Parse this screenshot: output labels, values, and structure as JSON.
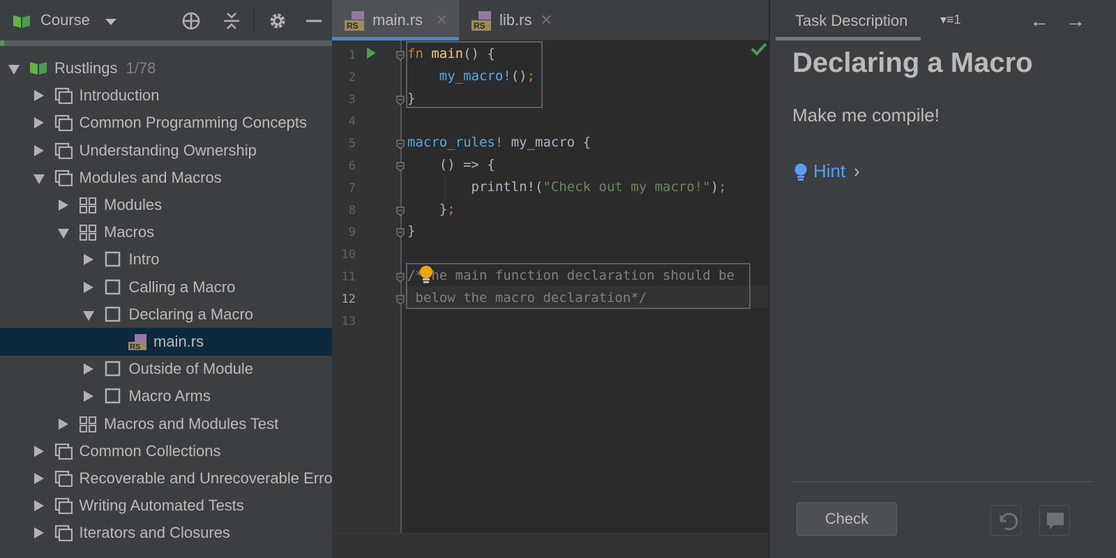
{
  "left_panel": {
    "title": "Course",
    "progress_fraction": 0.013,
    "tree": [
      {
        "label": "Rustlings",
        "count": "1/78",
        "level": 0,
        "expanded": true,
        "icon": "course-book-icon"
      },
      {
        "label": "Introduction",
        "level": 1,
        "expanded": false,
        "icon": "section-icon"
      },
      {
        "label": "Common Programming Concepts",
        "level": 1,
        "expanded": false,
        "icon": "section-icon"
      },
      {
        "label": "Understanding Ownership",
        "level": 1,
        "expanded": false,
        "icon": "section-icon"
      },
      {
        "label": "Modules and Macros",
        "level": 1,
        "expanded": true,
        "icon": "section-icon"
      },
      {
        "label": "Modules",
        "level": 2,
        "expanded": false,
        "icon": "lesson-grid-icon"
      },
      {
        "label": "Macros",
        "level": 2,
        "expanded": true,
        "icon": "lesson-grid-icon"
      },
      {
        "label": "Intro",
        "level": 3,
        "expanded": false,
        "icon": "task-icon"
      },
      {
        "label": "Calling a Macro",
        "level": 3,
        "expanded": false,
        "icon": "task-icon"
      },
      {
        "label": "Declaring a Macro",
        "level": 3,
        "expanded": true,
        "icon": "task-icon"
      },
      {
        "label": "main.rs",
        "level": 4,
        "leaf": true,
        "selected": true,
        "icon": "rust-file-icon"
      },
      {
        "label": "Outside of Module",
        "level": 3,
        "expanded": false,
        "icon": "task-icon"
      },
      {
        "label": "Macro Arms",
        "level": 3,
        "expanded": false,
        "icon": "task-icon"
      },
      {
        "label": "Macros and Modules Test",
        "level": 2,
        "expanded": false,
        "icon": "lesson-grid-icon"
      },
      {
        "label": "Common Collections",
        "level": 1,
        "expanded": false,
        "icon": "section-icon"
      },
      {
        "label": "Recoverable and Unrecoverable Errors",
        "level": 1,
        "expanded": false,
        "icon": "section-icon"
      },
      {
        "label": "Writing Automated Tests",
        "level": 1,
        "expanded": false,
        "icon": "section-icon"
      },
      {
        "label": "Iterators and Closures",
        "level": 1,
        "expanded": false,
        "icon": "section-icon"
      }
    ]
  },
  "editor": {
    "tabs": [
      {
        "label": "main.rs",
        "active": true
      },
      {
        "label": "lib.rs",
        "active": false
      }
    ],
    "current_line": 12,
    "lines": [
      {
        "n": "1",
        "html": "<span class=\"kw\">fn</span> <span class=\"fn\">main</span>() {"
      },
      {
        "n": "2",
        "html": "    <span class=\"mac\">my_macro!</span>()<span class=\"semi\">;</span>"
      },
      {
        "n": "3",
        "html": "}"
      },
      {
        "n": "4",
        "html": ""
      },
      {
        "n": "5",
        "html": "<span class=\"mac\">macro_rules!</span> my_macro {"
      },
      {
        "n": "6",
        "html": "    () => {"
      },
      {
        "n": "7",
        "html": "        println!(<span class=\"str\">\"Check out my macro!\"</span>)<span class=\"semi\">;</span>"
      },
      {
        "n": "8",
        "html": "    }<span class=\"semi\">;</span>"
      },
      {
        "n": "9",
        "html": "}"
      },
      {
        "n": "10",
        "html": ""
      },
      {
        "n": "11",
        "html": "<span class=\"cm\">/*The main function declaration should be</span>"
      },
      {
        "n": "12",
        "html": "<span class=\"cm\"> below the macro declaration*/</span>"
      },
      {
        "n": "13",
        "html": ""
      }
    ]
  },
  "task_panel": {
    "tab_label": "Task Description",
    "list_count": "1",
    "title": "Declaring a Macro",
    "body": "Make me compile!",
    "hint_label": "Hint",
    "check_button": "Check"
  },
  "colors": {
    "accent_blue": "#4a88c7",
    "progress_green": "#499c54",
    "selection": "#0d293e",
    "hint_link": "#589df6",
    "bulb": "#f0a30a"
  }
}
